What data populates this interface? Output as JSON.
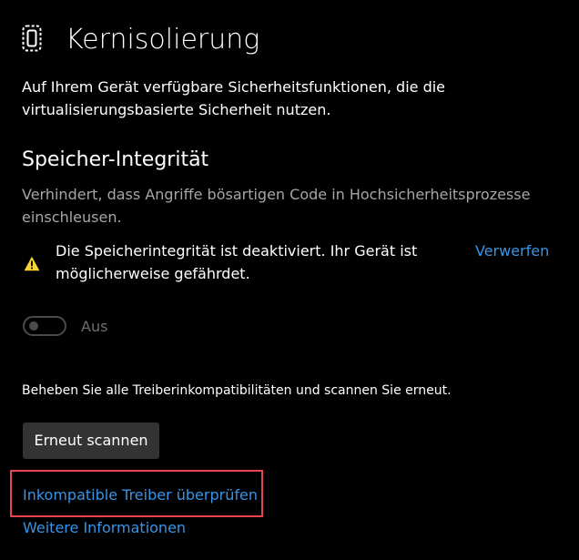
{
  "header": {
    "icon": "device-chip-icon",
    "title": "Kernisolierung",
    "description": "Auf Ihrem Gerät verfügbare Sicherheitsfunktionen, die die virtualisierungsbasierte Sicherheit nutzen."
  },
  "memory_integrity": {
    "title": "Speicher-Integrität",
    "description": "Verhindert, dass Angriffe bösartigen Code in Hochsicherheitsprozesse einschleusen.",
    "warning": {
      "icon": "warning-icon",
      "text": "Die Speicherintegrität ist deaktiviert. Ihr Gerät ist möglicherweise gefährdet.",
      "dismiss_label": "Verwerfen"
    },
    "toggle": {
      "state": false,
      "state_label": "Aus"
    }
  },
  "drivers": {
    "instruction": "Beheben Sie alle Treiberinkompatibilitäten und scannen Sie erneut.",
    "rescan_label": "Erneut scannen",
    "review_link": "Inkompatible Treiber überprüfen",
    "more_info_link": "Weitere Informationen"
  },
  "colors": {
    "background": "#000000",
    "link": "#3794e7",
    "warning": "#f7d332",
    "highlight": "#e8434f",
    "secondary_text": "#a6a6a6",
    "disabled": "#4a4a4a"
  }
}
